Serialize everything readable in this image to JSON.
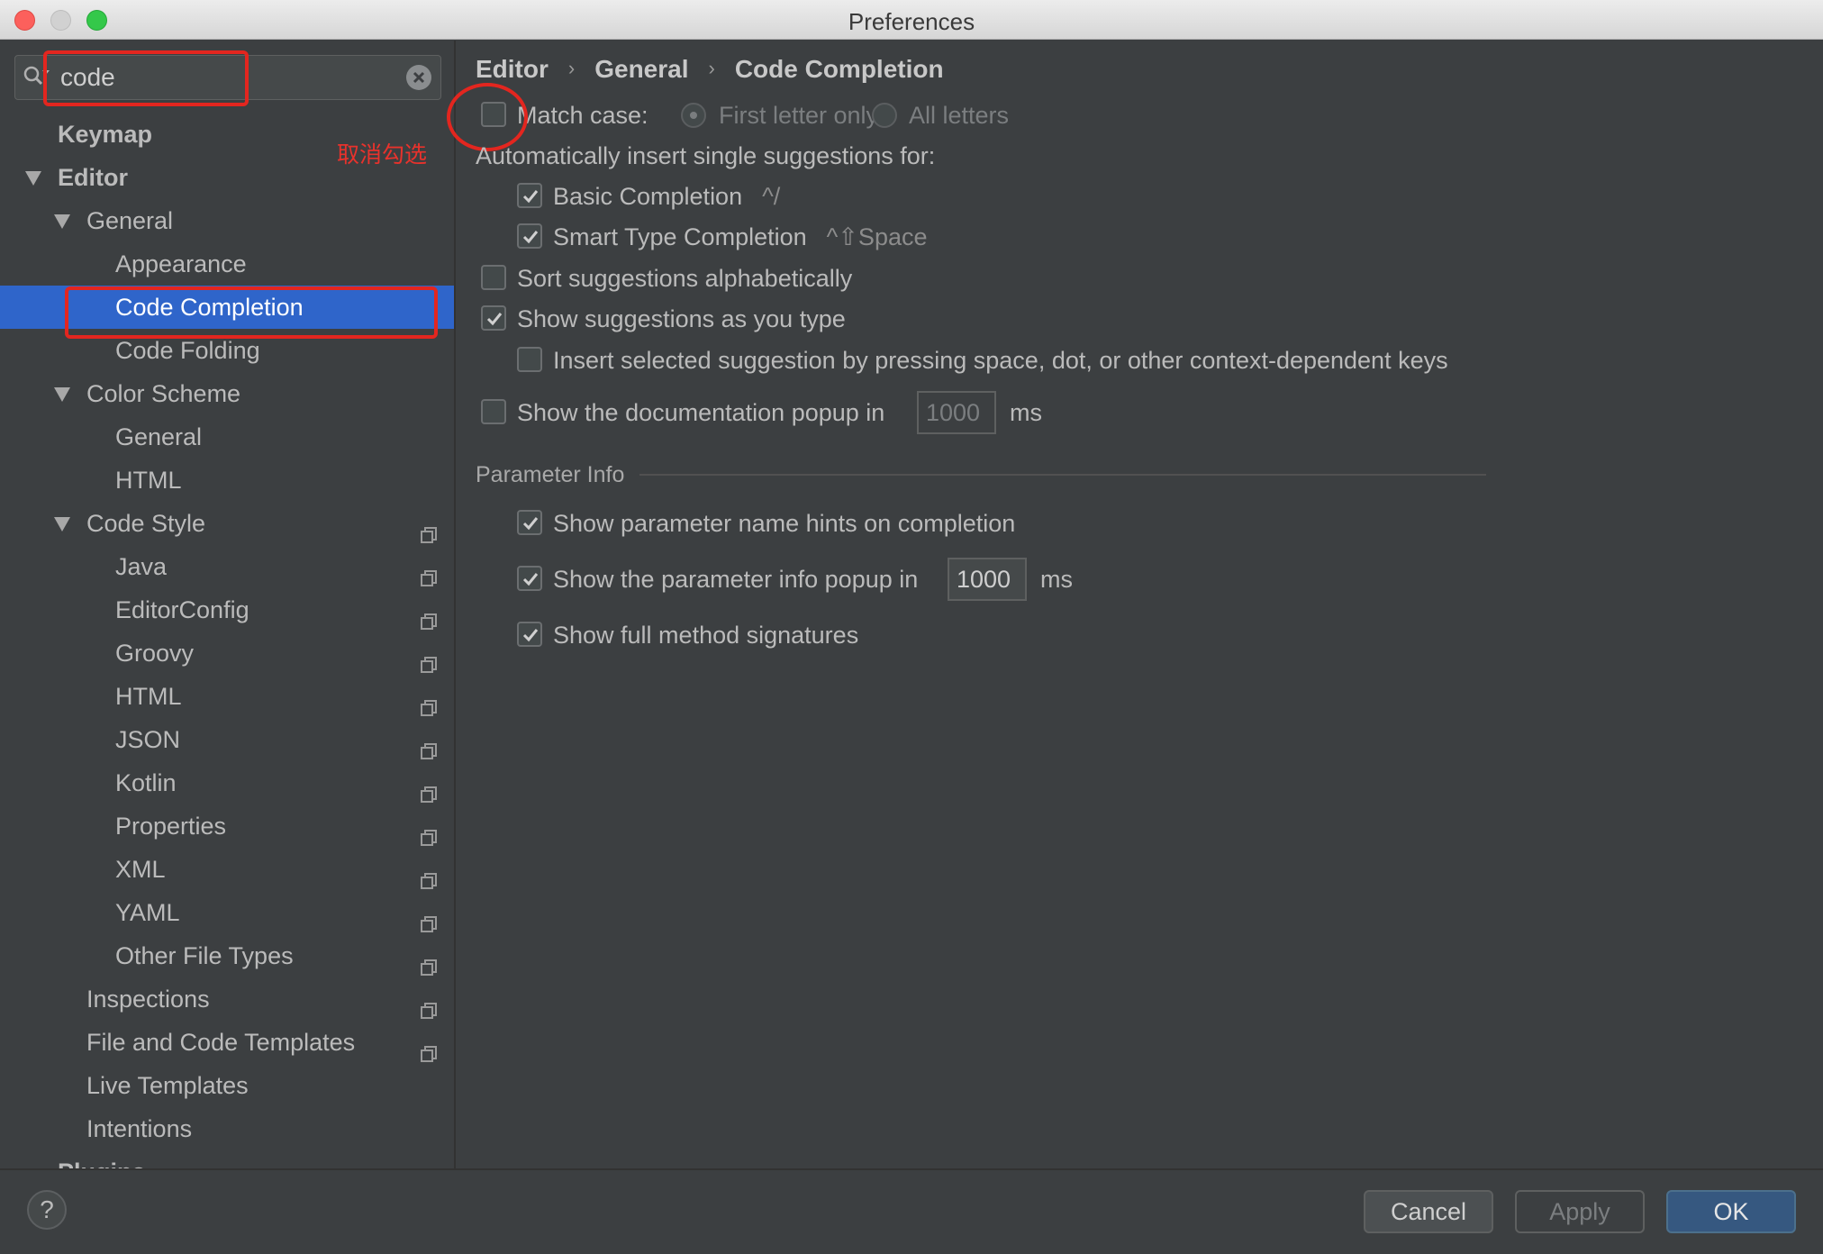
{
  "window": {
    "title": "Preferences"
  },
  "search": {
    "value": "code"
  },
  "annotation": {
    "text": "取消勾选"
  },
  "tree": [
    {
      "label": "Keymap"
    },
    {
      "label": "Editor"
    },
    {
      "label": "General"
    },
    {
      "label": "Appearance"
    },
    {
      "label": "Code Completion"
    },
    {
      "label": "Code Folding"
    },
    {
      "label": "Color Scheme"
    },
    {
      "label": "General"
    },
    {
      "label": "HTML"
    },
    {
      "label": "Code Style"
    },
    {
      "label": "Java"
    },
    {
      "label": "EditorConfig"
    },
    {
      "label": "Groovy"
    },
    {
      "label": "HTML"
    },
    {
      "label": "JSON"
    },
    {
      "label": "Kotlin"
    },
    {
      "label": "Properties"
    },
    {
      "label": "XML"
    },
    {
      "label": "YAML"
    },
    {
      "label": "Other File Types"
    },
    {
      "label": "Inspections"
    },
    {
      "label": "File and Code Templates"
    },
    {
      "label": "Live Templates"
    },
    {
      "label": "Intentions"
    },
    {
      "label": "Plugins"
    }
  ],
  "breadcrumb": [
    "Editor",
    "General",
    "Code Completion"
  ],
  "settings": {
    "match_case": {
      "label": "Match case:",
      "checked": false
    },
    "first_letter_only": "First letter only",
    "all_letters": "All letters",
    "auto_insert_header": "Automatically insert single suggestions for:",
    "basic_completion": {
      "label": "Basic Completion",
      "shortcut": "^/",
      "checked": true
    },
    "smart_type_completion": {
      "label": "Smart Type Completion",
      "shortcut": "^⇧Space",
      "checked": true
    },
    "sort_alpha": {
      "label": "Sort suggestions alphabetically",
      "checked": false
    },
    "show_as_you_type": {
      "label": "Show suggestions as you type",
      "checked": true
    },
    "insert_selected": {
      "label": "Insert selected suggestion by pressing space, dot, or other context-dependent keys",
      "checked": false
    },
    "doc_popup": {
      "label": "Show the documentation popup in",
      "value": "1000",
      "unit": "ms",
      "checked": false
    }
  },
  "parameter_info": {
    "title": "Parameter Info",
    "name_hints": {
      "label": "Show parameter name hints on completion",
      "checked": true
    },
    "info_popup": {
      "label": "Show the parameter info popup in",
      "value": "1000",
      "unit": "ms",
      "checked": true
    },
    "full_signatures": {
      "label": "Show full method signatures",
      "checked": true
    }
  },
  "footer": {
    "help": "?",
    "cancel": "Cancel",
    "apply": "Apply",
    "ok": "OK"
  },
  "colors": {
    "selection": "#2f65ca",
    "background": "#3c3f41",
    "annotation": "#e3261f",
    "ok_button": "#365880"
  }
}
